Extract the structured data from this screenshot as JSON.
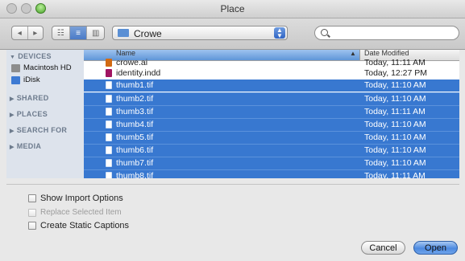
{
  "window": {
    "title": "Place"
  },
  "toolbar": {
    "nav_back": "◂",
    "nav_forward": "▸",
    "views": [
      "☷",
      "≡",
      "▥"
    ],
    "location": "Crowe",
    "search_value": "",
    "search_placeholder": ""
  },
  "sidebar": {
    "sections": [
      {
        "label": "DEVICES",
        "items": [
          {
            "label": "Macintosh HD",
            "icon": "hard-drive-icon",
            "color": "#8d8d8d"
          },
          {
            "label": "iDisk",
            "icon": "idisk-icon",
            "color": "#3d7ad3"
          }
        ]
      },
      {
        "label": "SHARED",
        "items": []
      },
      {
        "label": "PLACES",
        "items": []
      },
      {
        "label": "SEARCH FOR",
        "items": []
      },
      {
        "label": "MEDIA",
        "items": []
      }
    ]
  },
  "file_list": {
    "columns": {
      "name": "Name",
      "date": "Date Modified"
    },
    "rows": [
      {
        "name": "crowe.ai",
        "date": "Today, 11:11 AM",
        "selected": false,
        "icon_color": "#d26a12"
      },
      {
        "name": "identity.indd",
        "date": "Today, 12:27 PM",
        "selected": false,
        "icon_color": "#a01461"
      },
      {
        "name": "thumb1.tif",
        "date": "Today, 11:10 AM",
        "selected": true
      },
      {
        "name": "thumb2.tif",
        "date": "Today, 11:10 AM",
        "selected": true
      },
      {
        "name": "thumb3.tif",
        "date": "Today, 11:11 AM",
        "selected": true
      },
      {
        "name": "thumb4.tif",
        "date": "Today, 11:10 AM",
        "selected": true
      },
      {
        "name": "thumb5.tif",
        "date": "Today, 11:10 AM",
        "selected": true
      },
      {
        "name": "thumb6.tif",
        "date": "Today, 11:10 AM",
        "selected": true
      },
      {
        "name": "thumb7.tif",
        "date": "Today, 11:10 AM",
        "selected": true
      },
      {
        "name": "thumb8.tif",
        "date": "Today, 11:11 AM",
        "selected": true
      }
    ]
  },
  "options": {
    "show_import": "Show Import Options",
    "replace_selected": "Replace Selected Item",
    "create_captions": "Create Static Captions"
  },
  "buttons": {
    "cancel": "Cancel",
    "open": "Open"
  }
}
